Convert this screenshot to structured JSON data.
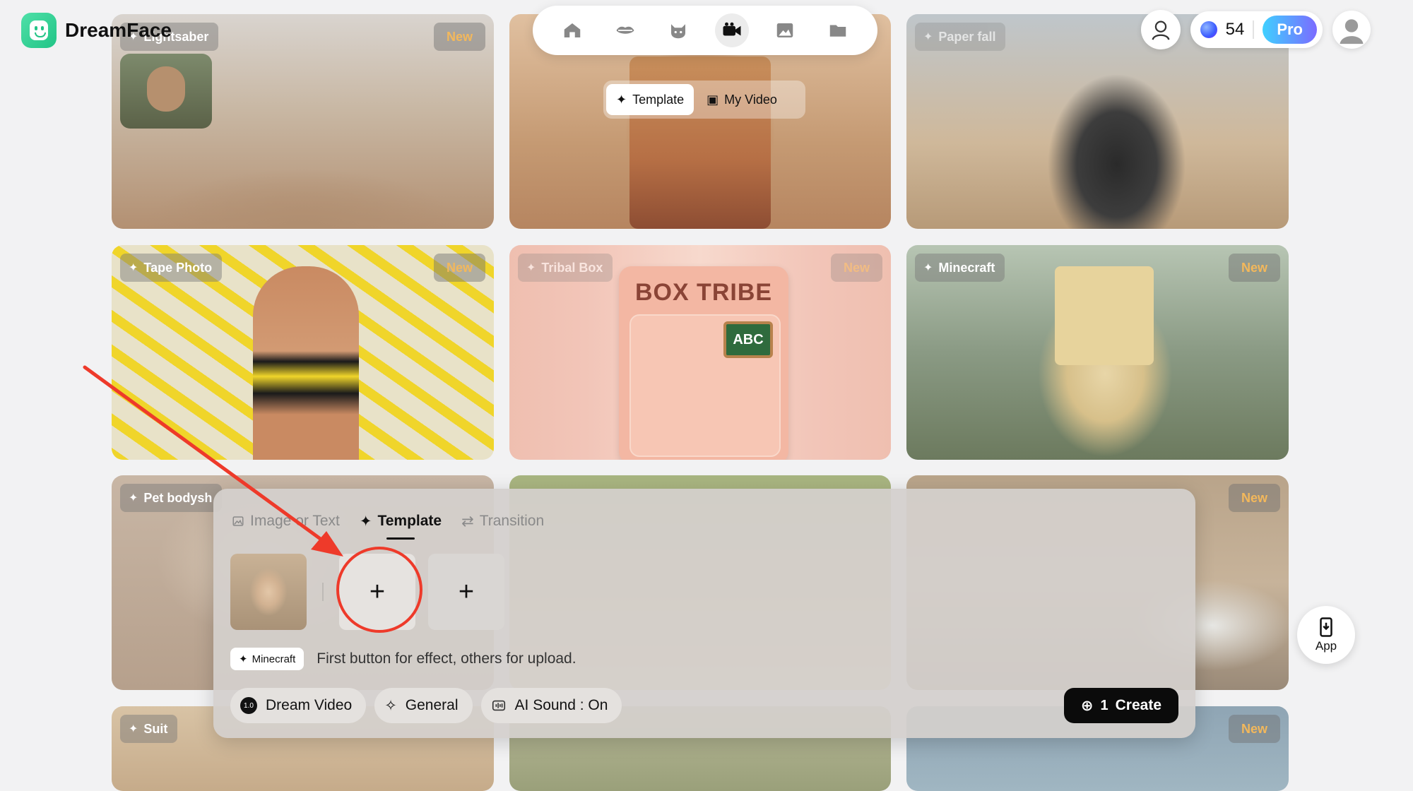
{
  "brand": {
    "name": "DreamFace"
  },
  "nav": {
    "items": [
      {
        "icon": "home-icon",
        "active": false
      },
      {
        "icon": "lips-icon",
        "active": false
      },
      {
        "icon": "cat-icon",
        "active": false
      },
      {
        "icon": "video-camera-icon",
        "active": true
      },
      {
        "icon": "image-icon",
        "active": false
      },
      {
        "icon": "folder-icon",
        "active": false
      }
    ]
  },
  "topright": {
    "credits": "54",
    "pro_label": "Pro"
  },
  "video_toggle": {
    "template_label": "Template",
    "my_video_label": "My Video"
  },
  "cards": [
    {
      "label": "Lightsaber",
      "badge": "New"
    },
    {
      "label": "",
      "badge": ""
    },
    {
      "label": "Paper fall",
      "badge": ""
    },
    {
      "label": "Tape Photo",
      "badge": "New"
    },
    {
      "label": "Tribal Box",
      "badge": "New",
      "art_text": "BOX TRIBE",
      "abc": "ABC"
    },
    {
      "label": "Minecraft",
      "badge": "New"
    },
    {
      "label": "Pet bodysh",
      "badge": ""
    },
    {
      "label": "",
      "badge": ""
    },
    {
      "label": "",
      "badge": "New"
    },
    {
      "label": "Suit",
      "badge": ""
    },
    {
      "label": "",
      "badge": ""
    },
    {
      "label": "",
      "badge": "New"
    }
  ],
  "panel": {
    "tabs": [
      {
        "label": "Image or Text",
        "active": false
      },
      {
        "label": "Template",
        "active": true
      },
      {
        "label": "Transition",
        "active": false
      }
    ],
    "plus_symbol": "+",
    "template_chip": "Minecraft",
    "hint": "First button for effect, others for upload.",
    "model_version": "1.0",
    "model_label": "Dream Video",
    "style_label": "General",
    "sound_label": "AI Sound : On",
    "create_cost": "1",
    "create_label": "Create"
  },
  "app_button": {
    "label": "App"
  },
  "colors": {
    "accent_red": "#ee3a2a",
    "pro_gradient_start": "#3fd0ff",
    "pro_gradient_end": "#7b6bff",
    "brand_green": "#22c486"
  }
}
